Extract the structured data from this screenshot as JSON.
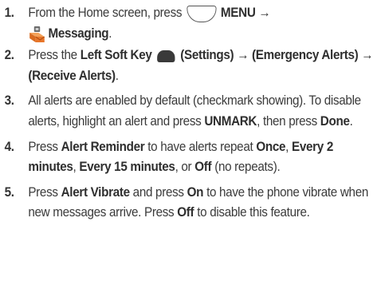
{
  "steps": [
    {
      "num": "1.",
      "t1": "From the Home screen, press",
      "icon1": "menu-key-icon",
      "b1": "MENU →",
      "icon2": "messaging-envelope-icon",
      "b2": "Messaging",
      "t2": "."
    },
    {
      "num": "2.",
      "t1": "Press the",
      "b1": "Left Soft Key",
      "icon1": "left-soft-key-icon",
      "b2": "(Settings) → (Emergency Alerts) → (Receive Alerts)",
      "t2": "."
    },
    {
      "num": "3.",
      "t1": "All alerts are enabled by default (checkmark showing). To disable alerts, highlight an alert and press",
      "b1": "UNMARK",
      "t2": ", then press",
      "b2": "Done",
      "t3": "."
    },
    {
      "num": "4.",
      "t1": "Press",
      "b1": "Alert Reminder",
      "t2": "to have alerts repeat",
      "b2": "Once",
      "t3": ",",
      "b3": "Every 2 minutes",
      "t4": ",",
      "b4": "Every 15 minutes",
      "t5": ", or",
      "b5": "Off",
      "t6": "(no repeats)."
    },
    {
      "num": "5.",
      "t1": "Press",
      "b1": "Alert Vibrate",
      "t2": "and press",
      "b2": "On",
      "t3": "to have the phone vibrate when new messages arrive. Press",
      "b3": "Off",
      "t4": "to disable this feature."
    }
  ],
  "colors": {
    "text": "#3b3b3b",
    "icon_dark": "#3a3a3a",
    "icon_accent": "#e8762a"
  }
}
